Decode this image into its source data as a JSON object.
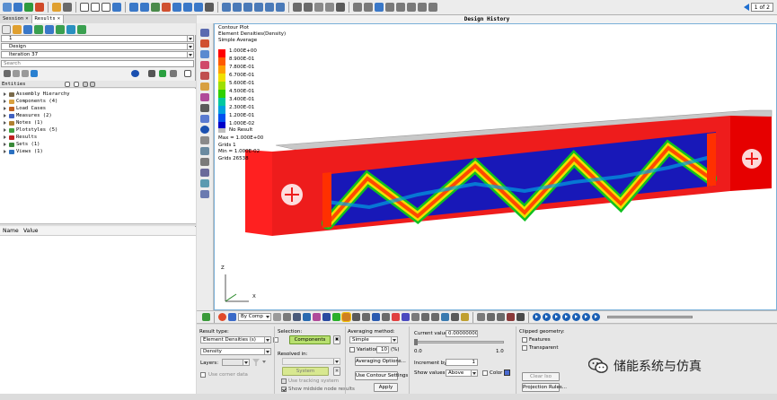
{
  "top_toolbar": {
    "page_indicator": "1 of 2"
  },
  "left_panel": {
    "tabs": [
      {
        "label": "Session"
      },
      {
        "label": "Results"
      }
    ],
    "selectors": [
      {
        "value": "1"
      },
      {
        "value": "Design"
      },
      {
        "value": "Iteration 37"
      }
    ],
    "search_placeholder": "Search",
    "entities_label": "Entities",
    "tree_items": [
      {
        "label": "Assembly Hierarchy",
        "icon_color": "#7a6a4a"
      },
      {
        "label": "Components (4)",
        "icon_color": "#d8a040"
      },
      {
        "label": "Load Cases",
        "icon_color": "#c06020"
      },
      {
        "label": "Measures (2)",
        "icon_color": "#4060c0"
      },
      {
        "label": "Notes (1)",
        "icon_color": "#b08030"
      },
      {
        "label": "Plotstyles (5)",
        "icon_color": "#40a040"
      },
      {
        "label": "Results",
        "icon_color": "#c02020"
      },
      {
        "label": "Sets (1)",
        "icon_color": "#3a8a3a"
      },
      {
        "label": "Views (1)",
        "icon_color": "#2a70c0"
      }
    ],
    "props_columns": [
      "Name",
      "Value"
    ]
  },
  "viewport": {
    "title": "Design History",
    "legend": {
      "title_lines": [
        "Contour Plot",
        "Element Densities(Density)",
        "Simple Average"
      ],
      "levels": [
        "1.000E+00",
        "8.900E-01",
        "7.800E-01",
        "6.700E-01",
        "5.600E-01",
        "4.500E-01",
        "3.400E-01",
        "2.300E-01",
        "1.200E-01",
        "1.000E-02"
      ],
      "colors": [
        "#ff0000",
        "#ff5a00",
        "#ffa000",
        "#f0e000",
        "#9ee000",
        "#30d000",
        "#00c8a0",
        "#00a0e0",
        "#0050f0",
        "#0000c8"
      ],
      "no_result_label": "No Result",
      "no_result_color": "#bfbfbf",
      "info_lines": [
        "Max = 1.000E+00",
        "Grids 1",
        "Min = 1.000E-02",
        "Grids 26538"
      ]
    },
    "triad": {
      "z": "Z",
      "x": "X"
    }
  },
  "bottom_toolbar": {
    "by_comp_label": "By Comp"
  },
  "bottom_panel": {
    "result_type_label": "Result type:",
    "result_type_value": "Element Densities (s)",
    "result_subtype_value": "Density",
    "layers_label": "Layers:",
    "use_corner_data_label": "Use corner data",
    "selection_label": "Selection:",
    "components_button": "Components",
    "resolved_in_label": "Resolved in:",
    "system_button": "System",
    "use_tracking_label": "Use tracking system",
    "show_midside_label": "Show midside node results",
    "averaging_method_label": "Averaging method:",
    "averaging_value": "Simple",
    "variation_label": "Variation <",
    "variation_value": "10",
    "variation_unit": "(%)",
    "averaging_options_button": "Averaging Options...",
    "contour_settings_button": "Use Contour Settings",
    "apply_button": "Apply",
    "current_value_label": "Current value:",
    "current_value": "0.00000000",
    "slider_min": "0.0",
    "slider_max": "1.0",
    "increment_label": "Increment by:",
    "increment_value": "1",
    "show_values_label": "Show values:",
    "show_values_select": "Above",
    "color_label": "Color",
    "clipped_geometry_label": "Clipped geometry:",
    "features_label": "Features",
    "transparent_label": "Transparent",
    "clear_iso_button": "Clear Iso",
    "projection_rules_button": "Projection Rules..."
  },
  "watermark": "储能系统与仿真"
}
